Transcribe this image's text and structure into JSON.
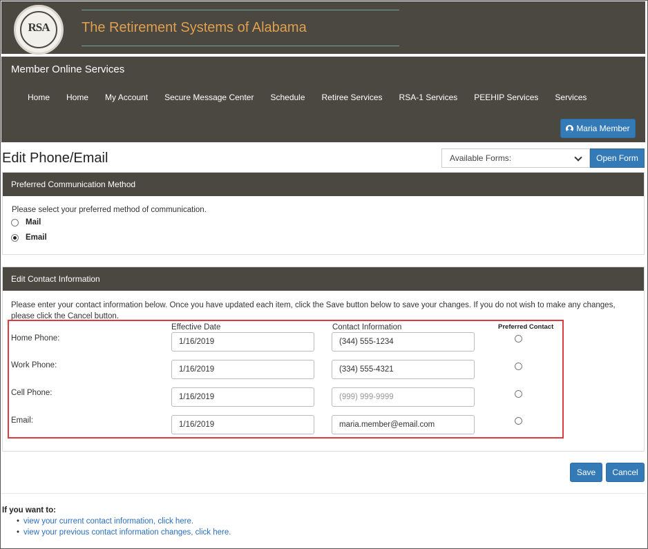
{
  "header": {
    "logo_text": "RSA",
    "logo_ring_text": "RETIREMENT SYSTEMS OF ALABAMA",
    "title": "The Retirement Systems of Alabama"
  },
  "nav": {
    "site_title": "Member Online Services",
    "items": [
      "Home",
      "Home",
      "My Account",
      "Secure Message Center",
      "Schedule",
      "Retiree Services",
      "RSA-1 Services",
      "PEEHIP Services",
      "Services"
    ],
    "user_button": "Maria Member"
  },
  "page": {
    "title": "Edit Phone/Email",
    "forms_select": "Available Forms:",
    "open_form_button": "Open Form"
  },
  "comm_panel": {
    "heading": "Preferred Communication Method",
    "instruction": "Please select your preferred method of communication.",
    "options": [
      {
        "label": "Mail",
        "selected": false
      },
      {
        "label": "Email",
        "selected": true
      }
    ]
  },
  "contact_panel": {
    "heading": "Edit Contact Information",
    "instruction": "Please enter your contact information below. Once you have updated each item, click the Save button below to save your changes. If you do not wish to make any changes, please click the Cancel button.",
    "col_effective": "Effective Date",
    "col_contact": "Contact Information",
    "col_preferred": "Preferred Contact",
    "rows": [
      {
        "label": "Home Phone:",
        "date": "1/16/2019",
        "contact": "(344) 555-1234",
        "placeholder": ""
      },
      {
        "label": "Work Phone:",
        "date": "1/16/2019",
        "contact": "(334) 555-4321",
        "placeholder": ""
      },
      {
        "label": "Cell Phone:",
        "date": "1/16/2019",
        "contact": "",
        "placeholder": "(999) 999-9999"
      },
      {
        "label": "Email:",
        "date": "1/16/2019",
        "contact": "maria.member@email.com",
        "placeholder": ""
      }
    ]
  },
  "actions": {
    "save": "Save",
    "cancel": "Cancel"
  },
  "footer": {
    "title": "If you want to:",
    "links": [
      "view your current contact information, click here.",
      "view your previous contact information changes, click here."
    ]
  },
  "colors": {
    "header_bg": "#4a4841",
    "brand_title": "#e0a04e",
    "button_blue": "#337ab7",
    "highlight_red": "#e03a3e"
  }
}
